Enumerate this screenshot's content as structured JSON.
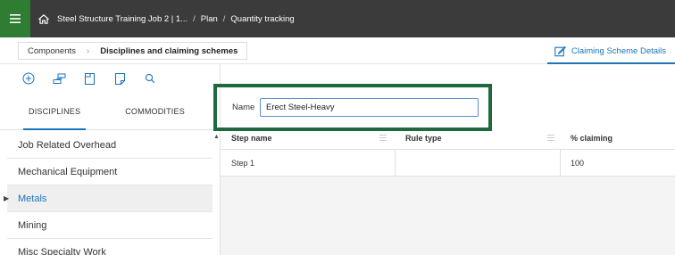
{
  "topbar": {
    "breadcrumb": [
      "Steel Structure Training Job 2 | 1...",
      "Plan",
      "Quantity tracking"
    ],
    "separator": "/"
  },
  "subnav": {
    "crumbs": [
      "Components",
      "Disciplines and claiming schemes"
    ],
    "details_label": "Claiming Scheme Details"
  },
  "toolbar": {
    "icons": [
      "add-circle-icon",
      "hierarchy-icon",
      "document-icon",
      "page-icon",
      "search-icon"
    ]
  },
  "tabs": [
    "DISCIPLINES",
    "COMMODITIES"
  ],
  "disciplines": [
    {
      "label": "Job Related Overhead",
      "selected": false
    },
    {
      "label": "Mechanical Equipment",
      "selected": false
    },
    {
      "label": "Metals",
      "selected": true
    },
    {
      "label": "Mining",
      "selected": false
    },
    {
      "label": "Misc Specialty Work",
      "selected": false
    }
  ],
  "scheme": {
    "name_label": "Name",
    "name_value": "Erect Steel-Heavy"
  },
  "grid": {
    "columns": [
      "Step name",
      "Rule type",
      "% claiming"
    ],
    "rows": [
      {
        "step_name": "Step 1",
        "rule_type": "",
        "claiming": "100"
      }
    ]
  },
  "colors": {
    "topbar_bg": "#3b3b3b",
    "menu_accent": "#2e7d32",
    "link_blue": "#1b75bb",
    "highlight": "#1e6a3e"
  }
}
